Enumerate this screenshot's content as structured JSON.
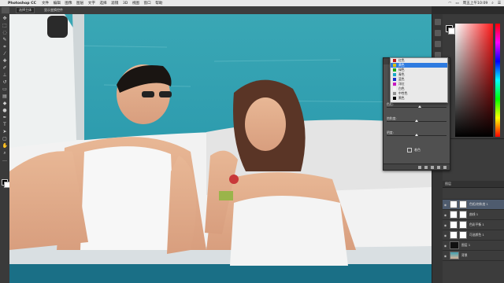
{
  "menubar": {
    "app_name": "Photoshop CC",
    "items": [
      "文件",
      "编辑",
      "图像",
      "图层",
      "文字",
      "选择",
      "滤镜",
      "3D",
      "视图",
      "窗口",
      "帮助"
    ],
    "clock": "周五上午10:09"
  },
  "options_bar": {
    "select_label": "选择主体",
    "checkbox_label": "显示变换控件"
  },
  "dropdown": {
    "items": [
      {
        "label": "红色",
        "color": "#c01818"
      },
      {
        "label": "黄色",
        "color": "#d8c012"
      },
      {
        "label": "绿色",
        "color": "#1aa818"
      },
      {
        "label": "青色",
        "color": "#18a8c8"
      },
      {
        "label": "蓝色",
        "color": "#1830c8"
      },
      {
        "label": "洋红",
        "color": "#c818c0"
      },
      {
        "label": "白色",
        "color": "#f4f4f4"
      },
      {
        "label": "中性色",
        "color": "#909090"
      },
      {
        "label": "黑色",
        "color": "#000000"
      }
    ],
    "selected_index": 1
  },
  "properties": {
    "sliders": [
      {
        "label": "色相:",
        "value": 0.55
      },
      {
        "label": "饱和度:",
        "value": 0.5
      },
      {
        "label": "明度:",
        "value": 0.5
      }
    ],
    "colorize_label": "着色"
  },
  "layers": {
    "header": "图层",
    "rows": [
      {
        "name": "色相/饱和度 1",
        "thumb": "white",
        "active": true
      },
      {
        "name": "曲线 1",
        "thumb": "white",
        "active": false
      },
      {
        "name": "色彩平衡 1",
        "thumb": "white",
        "active": false
      },
      {
        "name": "可选颜色 1",
        "thumb": "white",
        "active": false
      },
      {
        "name": "图层 1",
        "thumb": "mask",
        "active": false
      },
      {
        "name": "背景",
        "thumb": "photo",
        "active": false
      }
    ]
  },
  "colors": {
    "accent": "#2e7be0",
    "panel_bg": "#3c3c3c",
    "sea": "#2f9fb0"
  }
}
